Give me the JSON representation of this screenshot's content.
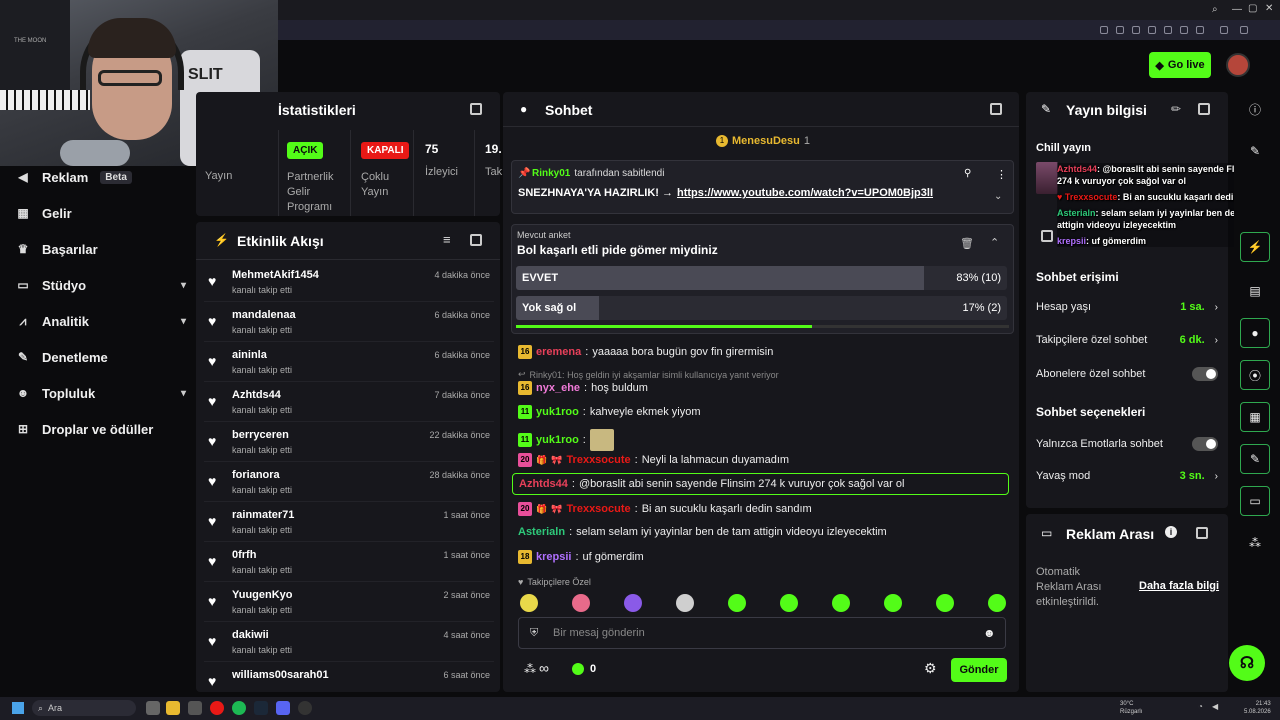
{
  "header": {
    "go_live": "Go live"
  },
  "sidebar": {
    "items": [
      {
        "label": "Reklam",
        "badge": "Beta",
        "icon": "megaphone-icon"
      },
      {
        "label": "Gelir",
        "icon": "chart-icon"
      },
      {
        "label": "Başarılar",
        "icon": "trophy-icon"
      },
      {
        "label": "Stüdyo",
        "icon": "studio-icon"
      },
      {
        "label": "Analitik",
        "icon": "analytics-icon"
      },
      {
        "label": "Denetleme",
        "icon": "wrench-icon"
      },
      {
        "label": "Topluluk",
        "icon": "people-icon"
      },
      {
        "label": "Droplar ve ödüller",
        "icon": "drops-icon"
      }
    ]
  },
  "webcam": {
    "chair_text": "SLIT",
    "poster_text": "THE MOON"
  },
  "stats": {
    "title": "İstatistikleri",
    "cols": [
      {
        "label": "Yayın"
      },
      {
        "label": "Partnerlik Gelir Programı",
        "badge": "AÇIK"
      },
      {
        "label": "Çoklu Yayın",
        "badge": "KAPALI"
      },
      {
        "value": "75",
        "label": "İzleyici"
      },
      {
        "value": "19.",
        "label": "Tak"
      }
    ]
  },
  "activity": {
    "title": "Etkinlik Akışı",
    "events": [
      {
        "name": "MehmetAkif1454",
        "sub": "kanalı takip etti",
        "time": "4 dakika önce"
      },
      {
        "name": "mandalenaa",
        "sub": "kanalı takip etti",
        "time": "6 dakika önce"
      },
      {
        "name": "aininla",
        "sub": "kanalı takip etti",
        "time": "6 dakika önce"
      },
      {
        "name": "Azhtds44",
        "sub": "kanalı takip etti",
        "time": "7 dakika önce"
      },
      {
        "name": "berryceren",
        "sub": "kanalı takip etti",
        "time": "22 dakika önce"
      },
      {
        "name": "forianora",
        "sub": "kanalı takip etti",
        "time": "28 dakika önce"
      },
      {
        "name": "rainmater71",
        "sub": "kanalı takip etti",
        "time": "1 saat önce"
      },
      {
        "name": "0frfh",
        "sub": "kanalı takip etti",
        "time": "1 saat önce"
      },
      {
        "name": "YuugenKyo",
        "sub": "kanalı takip etti",
        "time": "2 saat önce"
      },
      {
        "name": "dakiwii",
        "sub": "kanalı takip etti",
        "time": "4 saat önce"
      },
      {
        "name": "williams00sarah01",
        "sub": "",
        "time": "6 saat önce"
      }
    ]
  },
  "chat": {
    "title": "Sohbet",
    "top_user": "MenesuDesu",
    "top_count": "1",
    "pinned_by": "Rinky01",
    "pinned_suffix": "tarafından sabitlendi",
    "pinned_text": "SNEZHNAYA'YA HAZIRLIK! →",
    "pinned_link": "https://www.youtube.com/watch?v=UPOM0Bjp3lI",
    "poll_label": "Mevcut anket",
    "poll_question": "Bol kaşarlı etli pide gömer miydiniz",
    "poll_options": [
      {
        "label": "EVVET",
        "result": "83% (10)",
        "fraction": 0.83
      },
      {
        "label": "Yok sağ ol",
        "result": "17% (2)",
        "fraction": 0.17
      }
    ],
    "poll_timer_fraction": 0.6,
    "messages": [
      {
        "level": "16",
        "user": "eremena",
        "color": "#e8405a",
        "text": "yaaaaa bora bugün gov fin girermisin"
      },
      {
        "reply": "Rinky01: Hoş geldin iyi akşamlar isimli kullanıcıya yanıt veriyor"
      },
      {
        "level": "16",
        "user": "nyx_ehe",
        "color": "#f07ad8",
        "text": "hoş buldum"
      },
      {
        "level": "11",
        "user": "yuk1roo",
        "color": "#53fc18",
        "text": "kahveyle ekmek yiyom"
      },
      {
        "level": "11",
        "user": "yuk1roo",
        "color": "#53fc18",
        "text": ""
      },
      {
        "level": "20",
        "user": "Trexxsocute",
        "color": "#e91916",
        "text": "Neyli la lahmacun duyamadım"
      },
      {
        "user": "Azhtds44",
        "color": "#e8405a",
        "text": "@boraslit abi senin sayende Flinsim 274 k vuruyor çok sağol var ol",
        "highlight": true
      },
      {
        "level": "20",
        "user": "Trexxsocute",
        "color": "#e91916",
        "text": "Bi an sucuklu kaşarlı dedin sandım"
      },
      {
        "user": "Asterialn",
        "color": "#2ec97a",
        "text": "selam selam iyi yayinlar ben de tam attigin videoyu izleyecektim"
      },
      {
        "level": "18",
        "user": "krepsii",
        "color": "#b070ff",
        "text": "uf gömerdim"
      }
    ],
    "followers_only": "Takipçilere Özel",
    "input_placeholder": "Bir mesaj gönderin",
    "points": "0",
    "send": "Gönder"
  },
  "info": {
    "title": "Yayın bilgisi",
    "category": "Chill yayın",
    "overlay": [
      {
        "user": "Azhtds44",
        "text": "@boraslit abi senin sayende Flinsim 274 k vuruyor çok sağol var ol"
      },
      {
        "user": "Trexxsocute",
        "text": "Bi an sucuklu kaşarlı dedin sandım"
      },
      {
        "user": "Asterialn",
        "text": "selam selam iyi yayinlar ben de tam attigin videoyu izleyecektim"
      },
      {
        "user": "krepsii",
        "text": "uf gömerdim"
      }
    ],
    "access_title": "Sohbet erişimi",
    "account_age": {
      "label": "Hesap yaşı",
      "value": "1 sa."
    },
    "followers_chat": {
      "label": "Takipçilere özel sohbet",
      "value": "6 dk."
    },
    "subs_chat": {
      "label": "Abonelere özel sohbet"
    },
    "options_title": "Sohbet seçenekleri",
    "emote_only": {
      "label": "Yalnızca Emotlarla sohbet"
    },
    "slow_mode": {
      "label": "Yavaş mod",
      "value": "3 sn."
    }
  },
  "ad": {
    "title": "Reklam Arası",
    "text": "Otomatik Reklam Arası etkinleştirildi.",
    "link": "Daha fazla bilgi"
  },
  "taskbar": {
    "search": "Ara",
    "weather_temp": "30°C",
    "weather_label": "Rüzgarlı",
    "time": "21:43",
    "date": "5.08.2026"
  },
  "colors": {
    "accent": "#53fc18",
    "bg": "#0b0b0d",
    "panel": "#17171c"
  }
}
